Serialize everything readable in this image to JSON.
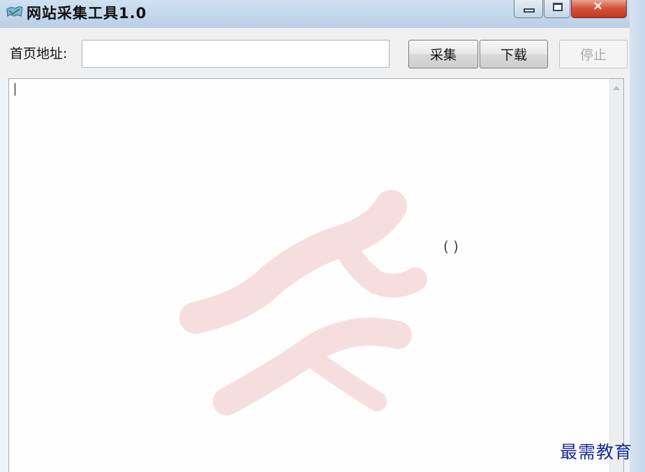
{
  "window": {
    "title": "网站采集工具1.0",
    "app_icon": "app-icon"
  },
  "toolbar": {
    "url_label": "首页地址:",
    "url_value": "",
    "collect_label": "采集",
    "download_label": "下载",
    "stop_label": "停止"
  },
  "log": {
    "text": ""
  },
  "watermark": {
    "brand_text": "最需教育"
  },
  "colors": {
    "titlebar": "#c3d7ec",
    "close_button": "#c1371f",
    "brand_text": "#1a2c9a",
    "watermark_stroke": "#f5d8d8"
  }
}
